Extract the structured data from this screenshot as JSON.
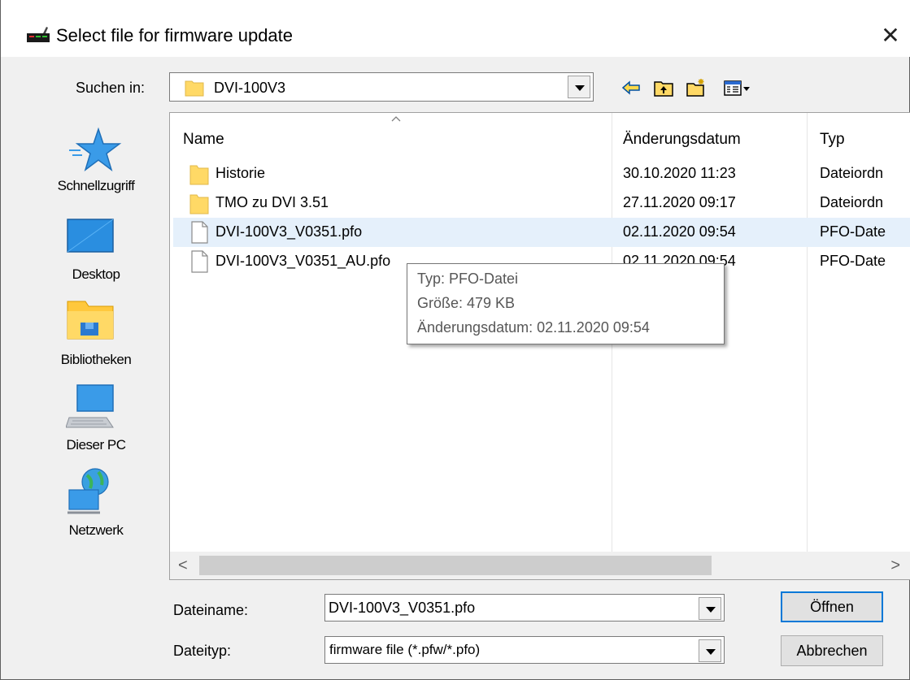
{
  "window": {
    "title": "Select file for firmware update",
    "close_symbol": "✕"
  },
  "toolbar": {
    "look_in_label": "Suchen in:",
    "look_in_value": "DVI-100V3",
    "icons": [
      "back-icon",
      "up-folder-icon",
      "new-folder-icon",
      "view-menu-icon"
    ]
  },
  "places": [
    {
      "label": "Schnellzugriff",
      "icon": "star-icon"
    },
    {
      "label": "Desktop",
      "icon": "desktop-icon"
    },
    {
      "label": "Bibliotheken",
      "icon": "library-icon"
    },
    {
      "label": "Dieser PC",
      "icon": "computer-icon"
    },
    {
      "label": "Netzwerk",
      "icon": "network-icon"
    }
  ],
  "columns": {
    "name": "Name",
    "date": "Änderungsdatum",
    "type": "Typ"
  },
  "files": [
    {
      "name": "Historie",
      "date": "30.10.2020 11:23",
      "type": "Dateiordn",
      "kind": "folder"
    },
    {
      "name": "TMO zu DVI 3.51",
      "date": "27.11.2020 09:17",
      "type": "Dateiordn",
      "kind": "folder"
    },
    {
      "name": "DVI-100V3_V0351.pfo",
      "date": "02.11.2020 09:54",
      "type": "PFO-Date",
      "kind": "file",
      "selected": true
    },
    {
      "name": "DVI-100V3_V0351_AU.pfo",
      "date": "02.11.2020 09:54",
      "type": "PFO-Date",
      "kind": "file"
    }
  ],
  "tooltip": {
    "line1": "Typ: PFO-Datei",
    "line2": "Größe: 479 KB",
    "line3": "Änderungsdatum: 02.11.2020 09:54"
  },
  "scrollbar": {
    "left_arrow": "<",
    "right_arrow": ">"
  },
  "footer": {
    "filename_label": "Dateiname:",
    "filename_value": "DVI-100V3_V0351.pfo",
    "filetype_label": "Dateityp:",
    "filetype_value": "firmware file (*.pfw/*.pfo)",
    "open_button": "Öffnen",
    "cancel_button": "Abbrechen"
  },
  "colors": {
    "selection": "#e5f0fb",
    "default_button_border": "#0078d7",
    "folder": "#ffd966"
  }
}
